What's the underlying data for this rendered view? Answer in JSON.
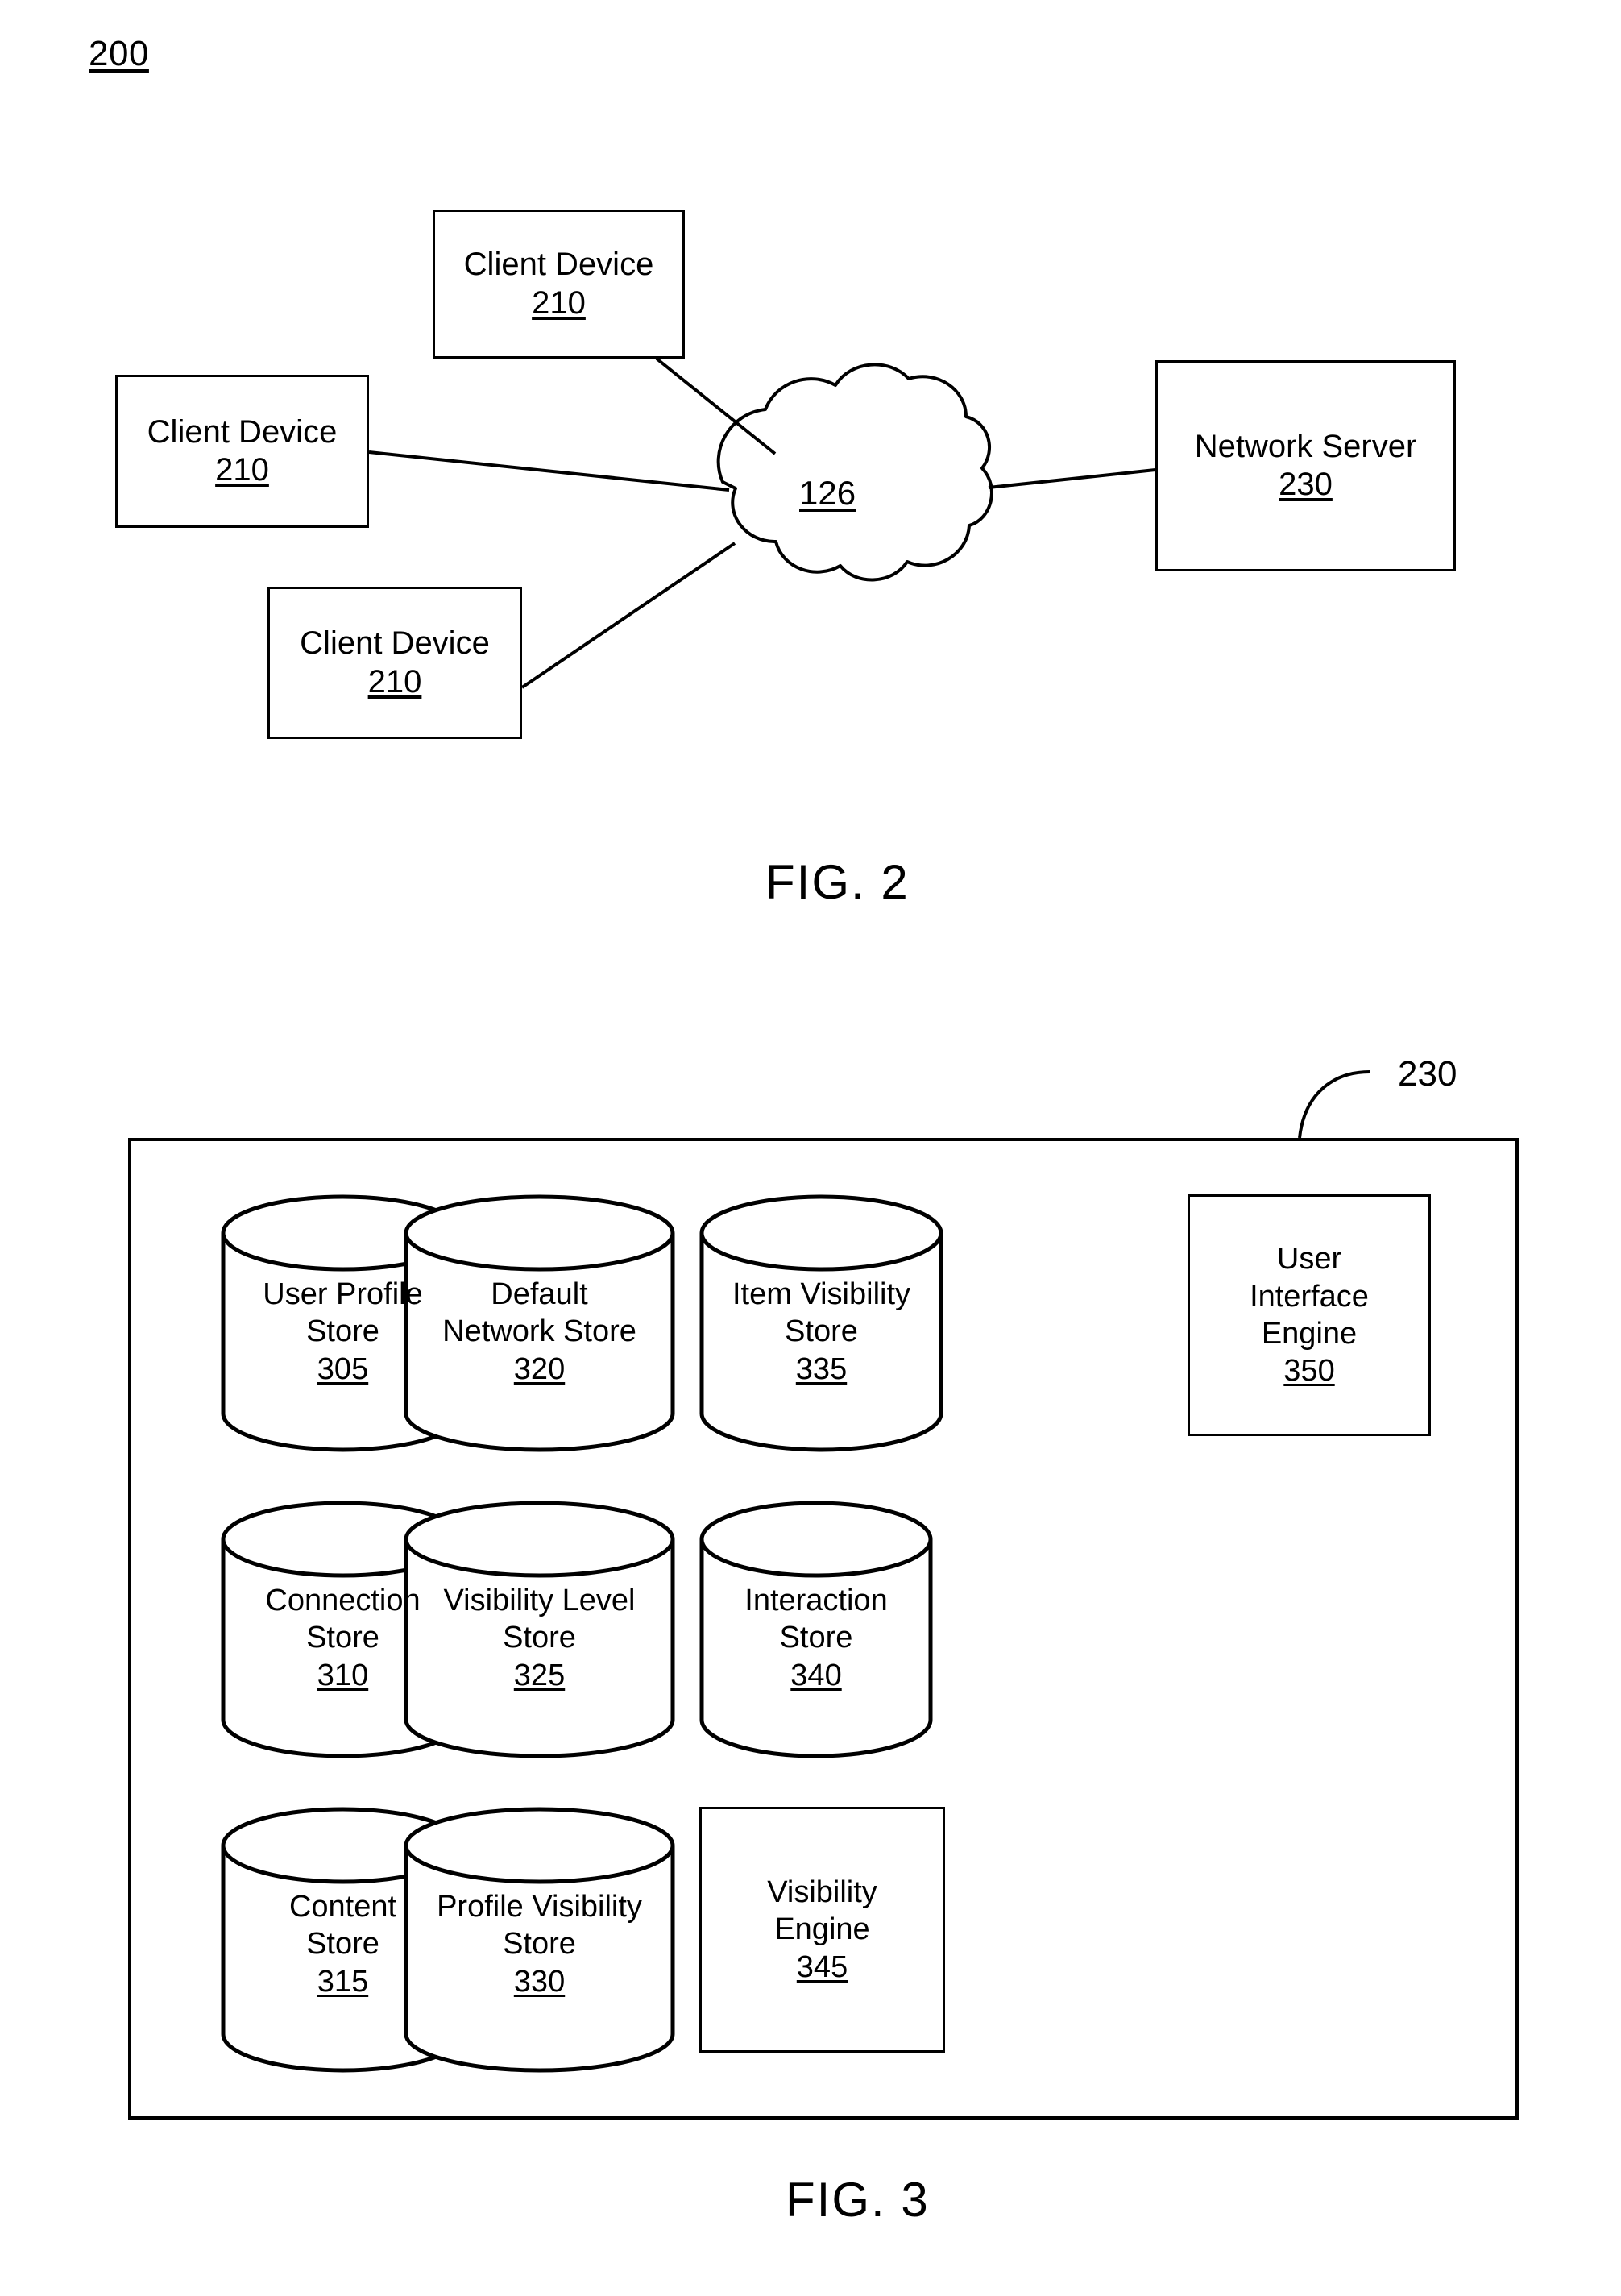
{
  "figures": [
    {
      "id": "fig2",
      "caption": "FIG. 2",
      "system_ref": "200",
      "nodes": {
        "client_top": {
          "label": "Client Device",
          "ref": "210"
        },
        "client_left": {
          "label": "Client Device",
          "ref": "210"
        },
        "client_bottom": {
          "label": "Client Device",
          "ref": "210"
        },
        "network_cloud": {
          "ref": "126"
        },
        "network_server": {
          "label": "Network Server",
          "ref": "230"
        }
      }
    },
    {
      "id": "fig3",
      "caption": "FIG. 3",
      "container_ref": "230",
      "components": [
        {
          "name": "User Profile Store",
          "line1": "User Profile",
          "line2": "Store",
          "ref": "305",
          "shape": "cylinder"
        },
        {
          "name": "Default Network Store",
          "line1": "Default",
          "line2": "Network Store",
          "ref": "320",
          "shape": "cylinder"
        },
        {
          "name": "Item Visibility Store",
          "line1": "Item Visibility",
          "line2": "Store",
          "ref": "335",
          "shape": "cylinder"
        },
        {
          "name": "User Interface Engine",
          "line1": "User",
          "line2": "Interface",
          "line3": "Engine",
          "ref": "350",
          "shape": "rectangle"
        },
        {
          "name": "Connection Store",
          "line1": "Connection",
          "line2": "Store",
          "ref": "310",
          "shape": "cylinder"
        },
        {
          "name": "Visibility Level Store",
          "line1": "Visibility Level",
          "line2": "Store",
          "ref": "325",
          "shape": "cylinder"
        },
        {
          "name": "Interaction Store",
          "line1": "Interaction",
          "line2": "Store",
          "ref": "340",
          "shape": "cylinder"
        },
        {
          "name": "Content Store",
          "line1": "Content",
          "line2": "Store",
          "ref": "315",
          "shape": "cylinder"
        },
        {
          "name": "Profile Visibility Store",
          "line1": "Profile Visibility",
          "line2": "Store",
          "ref": "330",
          "shape": "cylinder"
        },
        {
          "name": "Visibility Engine",
          "line1": "Visibility",
          "line2": "Engine",
          "ref": "345",
          "shape": "rectangle"
        }
      ]
    }
  ],
  "colors": {
    "ink": "#000000",
    "paper": "#ffffff"
  }
}
